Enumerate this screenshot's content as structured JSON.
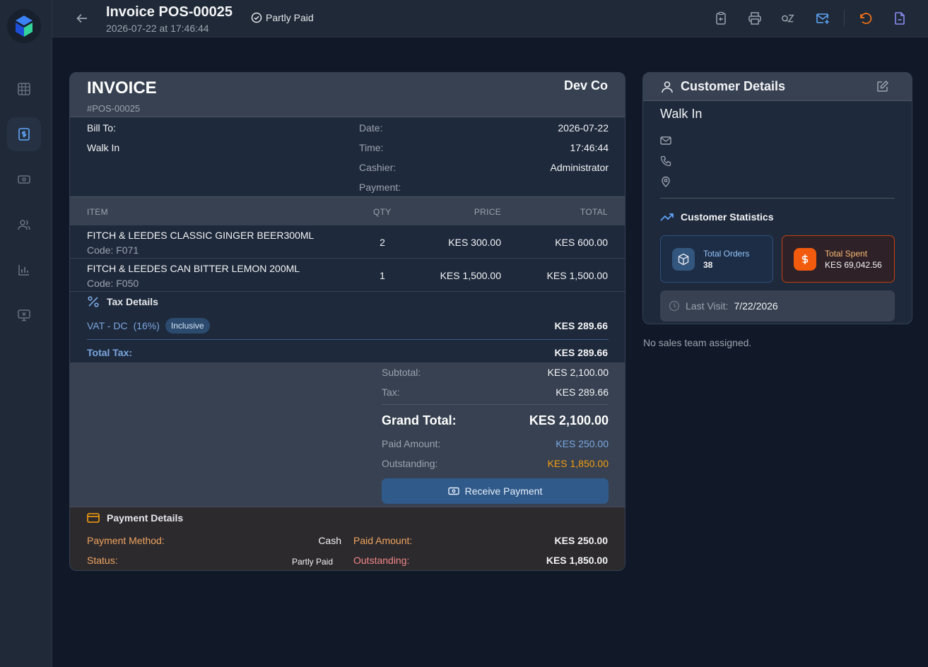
{
  "topbar": {
    "title": "Invoice POS-00025",
    "subtitle": "2026-07-22 at 17:46:44",
    "status": "Partly Paid"
  },
  "invoice": {
    "heading": "INVOICE",
    "number": "#POS-00025",
    "company": "Dev Co",
    "bill_to_label": "Bill To:",
    "bill_to_name": "Walk In",
    "meta": [
      {
        "label": "Date:",
        "value": "2026-07-22"
      },
      {
        "label": "Time:",
        "value": "17:46:44"
      },
      {
        "label": "Cashier:",
        "value": "Administrator"
      },
      {
        "label": "Payment:",
        "value": ""
      }
    ],
    "columns": {
      "item": "ITEM",
      "qty": "QTY",
      "price": "PRICE",
      "total": "TOTAL"
    },
    "items": [
      {
        "name": "FITCH & LEEDES CLASSIC GINGER BEER300ML",
        "code": "Code: F071",
        "qty": "2",
        "price": "KES 300.00",
        "total": "KES 600.00"
      },
      {
        "name": "FITCH & LEEDES CAN BITTER LEMON 200ML",
        "code": "Code: F050",
        "qty": "1",
        "price": "KES 1,500.00",
        "total": "KES 1,500.00"
      }
    ],
    "tax": {
      "title": "Tax Details",
      "line_name": "VAT - DC",
      "line_rate": "(16%)",
      "line_badge": "Inclusive",
      "line_amount": "KES 289.66",
      "total_label": "Total Tax:",
      "total_value": "KES 289.66"
    },
    "summary": {
      "subtotal_label": "Subtotal:",
      "subtotal_value": "KES 2,100.00",
      "tax_label": "Tax:",
      "tax_value": "KES 289.66",
      "grand_label": "Grand Total:",
      "grand_value": "KES 2,100.00",
      "paid_label": "Paid Amount:",
      "paid_value": "KES 250.00",
      "outstanding_label": "Outstanding:",
      "outstanding_value": "KES 1,850.00",
      "receive_button": "Receive Payment"
    },
    "payment_details": {
      "title": "Payment Details",
      "method_label": "Payment Method:",
      "method_value": "Cash",
      "status_label": "Status:",
      "status_value": "Partly Paid",
      "paid_label": "Paid Amount:",
      "paid_value": "KES 250.00",
      "outstanding_label": "Outstanding:",
      "outstanding_value": "KES 1,850.00"
    }
  },
  "customer": {
    "title": "Customer Details",
    "name": "Walk In",
    "stats_title": "Customer Statistics",
    "orders_label": "Total Orders",
    "orders_value": "38",
    "spent_label": "Total Spent",
    "spent_value": "KES 69,042.56",
    "last_visit_label": "Last Visit:",
    "last_visit_value": "7/22/2026"
  },
  "sales_team_note": "No sales team assigned.",
  "colors": {
    "background": "#111827",
    "panel": "#1e293b",
    "accent_blue": "#305a8a",
    "paid_blue": "#7aa7e0",
    "outstanding_orange": "#f59e0b",
    "spent_orange": "#f25a0e"
  },
  "icons": {
    "sidebar": [
      "grid-icon",
      "invoice-dollar-icon",
      "cash-icon",
      "users-icon",
      "bar-chart-icon",
      "monitor-x-icon"
    ],
    "toolbar": [
      "clipboard-copy-icon",
      "printer-icon",
      "qz-icon",
      "mail-plus-icon",
      "undo-icon",
      "file-minus-icon"
    ]
  }
}
